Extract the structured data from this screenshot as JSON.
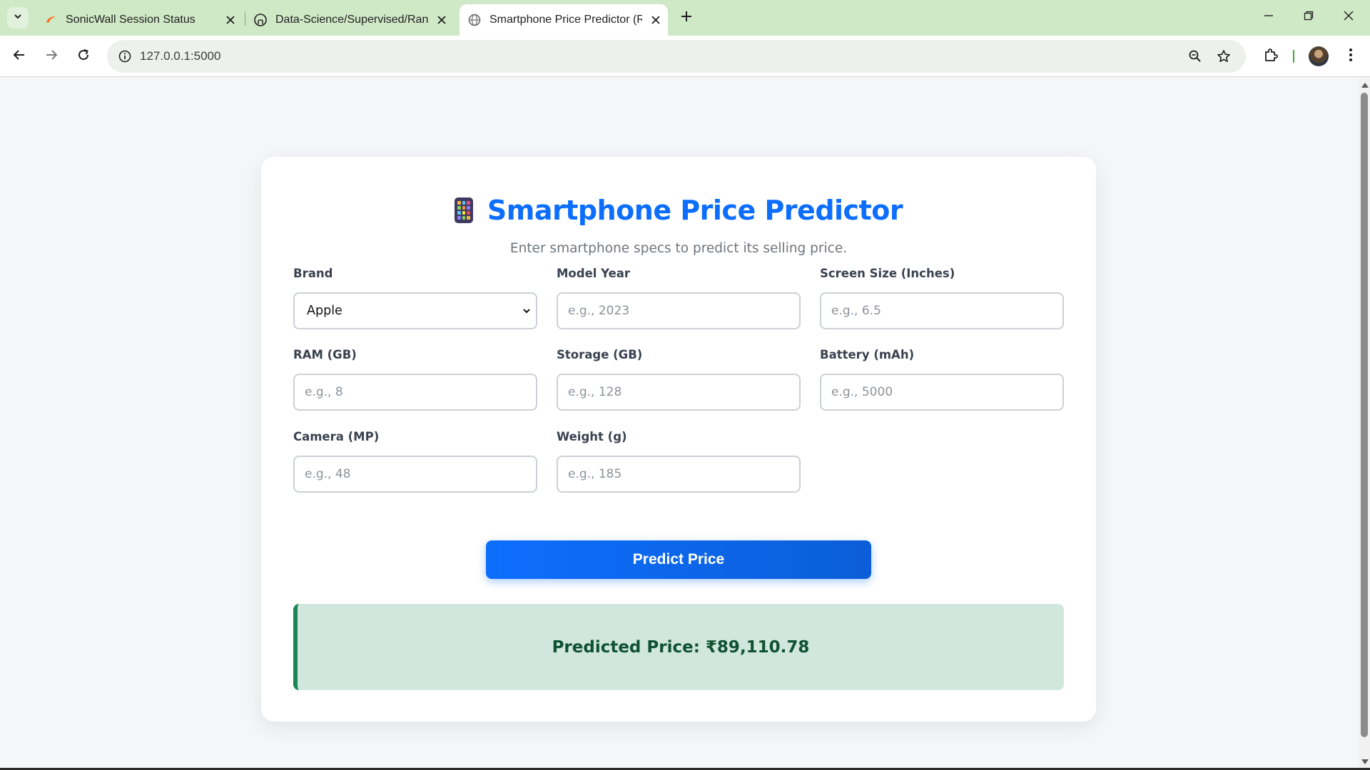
{
  "browser": {
    "tabs": [
      {
        "title": "SonicWall Session Status",
        "icon": "sonicwall-icon"
      },
      {
        "title": "Data-Science/Supervised/Rand…",
        "icon": "github-icon"
      },
      {
        "title": "Smartphone Price Predictor (Ri…",
        "icon": "globe-icon",
        "active": true
      }
    ],
    "url": "127.0.0.1:5000"
  },
  "page": {
    "title": "Smartphone Price Predictor",
    "subtitle": "Enter smartphone specs to predict its selling price.",
    "fields": {
      "brand": {
        "label": "Brand",
        "value": "Apple"
      },
      "model_year": {
        "label": "Model Year",
        "placeholder": "e.g., 2023"
      },
      "screen_size": {
        "label": "Screen Size (Inches)",
        "placeholder": "e.g., 6.5"
      },
      "ram": {
        "label": "RAM (GB)",
        "placeholder": "e.g., 8"
      },
      "storage": {
        "label": "Storage (GB)",
        "placeholder": "e.g., 128"
      },
      "battery": {
        "label": "Battery (mAh)",
        "placeholder": "e.g., 5000"
      },
      "camera": {
        "label": "Camera (MP)",
        "placeholder": "e.g., 48"
      },
      "weight": {
        "label": "Weight (g)",
        "placeholder": "e.g., 185"
      }
    },
    "predict_button": "Predict Price",
    "result": "Predicted Price: ₹89,110.78"
  },
  "colors": {
    "accent": "#0d6efd",
    "result_bg": "#d1e7dd",
    "result_text": "#0f5132",
    "tabstrip": "#cfe8c6"
  }
}
